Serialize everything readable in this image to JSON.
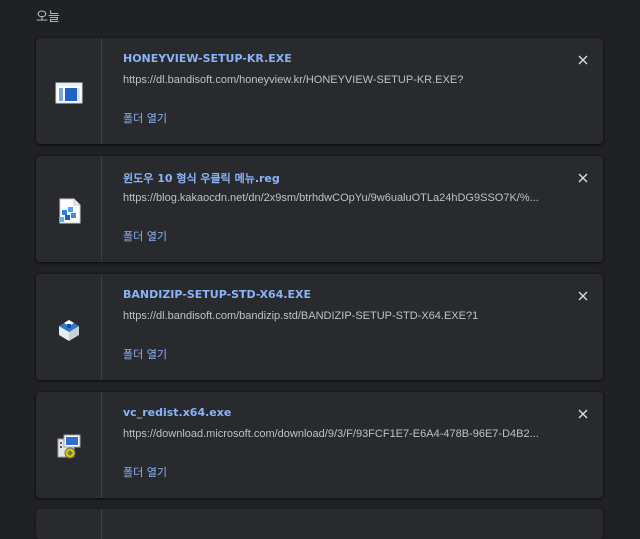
{
  "section": {
    "date_label": "오늘"
  },
  "downloads": [
    {
      "name": "HONEYVIEW-SETUP-KR.EXE",
      "url": "https://dl.bandisoft.com/honeyview.kr/HONEYVIEW-SETUP-KR.EXE?",
      "action": "폴더 열기",
      "icon": "honeyview-installer-icon"
    },
    {
      "name": "윈도우 10 형식 우클릭 메뉴.reg",
      "url": "https://blog.kakaocdn.net/dn/2x9sm/btrhdwCOpYu/9w6ualuOTLa24hDG9SSO7K/%...",
      "action": "폴더 열기",
      "icon": "registry-file-icon"
    },
    {
      "name": "BANDIZIP-SETUP-STD-X64.EXE",
      "url": "https://dl.bandisoft.com/bandizip.std/BANDIZIP-SETUP-STD-X64.EXE?1",
      "action": "폴더 열기",
      "icon": "bandizip-installer-icon"
    },
    {
      "name": "vc_redist.x64.exe",
      "url": "https://download.microsoft.com/download/9/3/F/93FCF1E7-E6A4-478B-96E7-D4B2...",
      "action": "폴더 열기",
      "icon": "vc-redist-installer-icon"
    }
  ],
  "colors": {
    "background": "#202124",
    "card": "#292a2d",
    "link": "#8ab4f8",
    "text_secondary": "#bdc1c6"
  }
}
